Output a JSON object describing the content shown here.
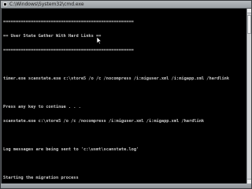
{
  "window": {
    "title": "C:\\Windows\\System32\\cmd.exe"
  },
  "console": {
    "lines": [
      "====================================================",
      "== User State Gather With Hard Links ==",
      "====================================================",
      "",
      "timer.exe scanstate.exe c:\\store5 /o /c /nocompress /i:miguser.xml /i:migapp.xml /hardlink",
      "",
      "Press any key to continue . . .",
      "scanstate.exe c:\\store5 /o /c /nocompress /i:miguser.xml /i:migapp.xml /hardlink",
      "",
      "Log messages are being sent to 'c:\\usmt\\scanstate.log'",
      "",
      "Starting the migration process"
    ]
  },
  "colors": {
    "console_bg": "#000000",
    "console_fg": "#c9c9c9",
    "titlebar": "#aab0b4"
  },
  "icons": {
    "app": "console-icon",
    "pointer": "mouse-pointer-icon"
  }
}
